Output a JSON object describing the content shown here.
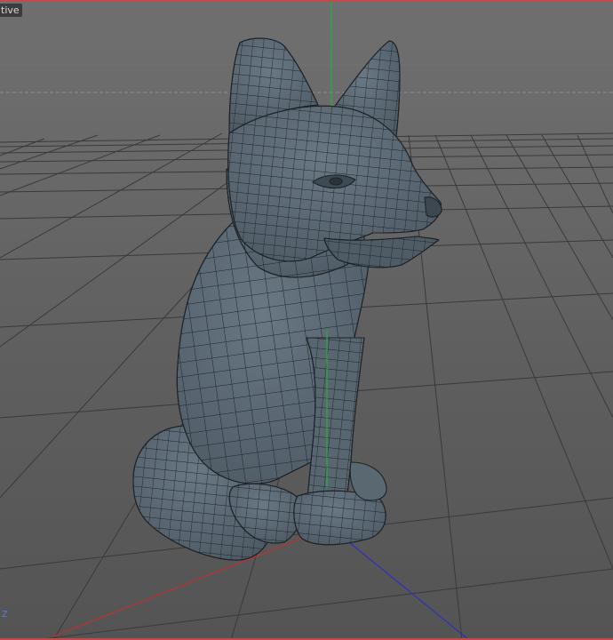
{
  "viewport": {
    "camera_label": "tive",
    "axis_label": "Z",
    "grid_color": "#3a3a3a",
    "horizon_line_color": "#8c8c8c",
    "axis_x_color": "#c03030",
    "axis_y_color": "#27b03a",
    "axis_z_color": "#2d2fc2",
    "mesh_fill": "#56646f",
    "mesh_wire": "#1e2328",
    "frame_color": "#c24a4a"
  }
}
